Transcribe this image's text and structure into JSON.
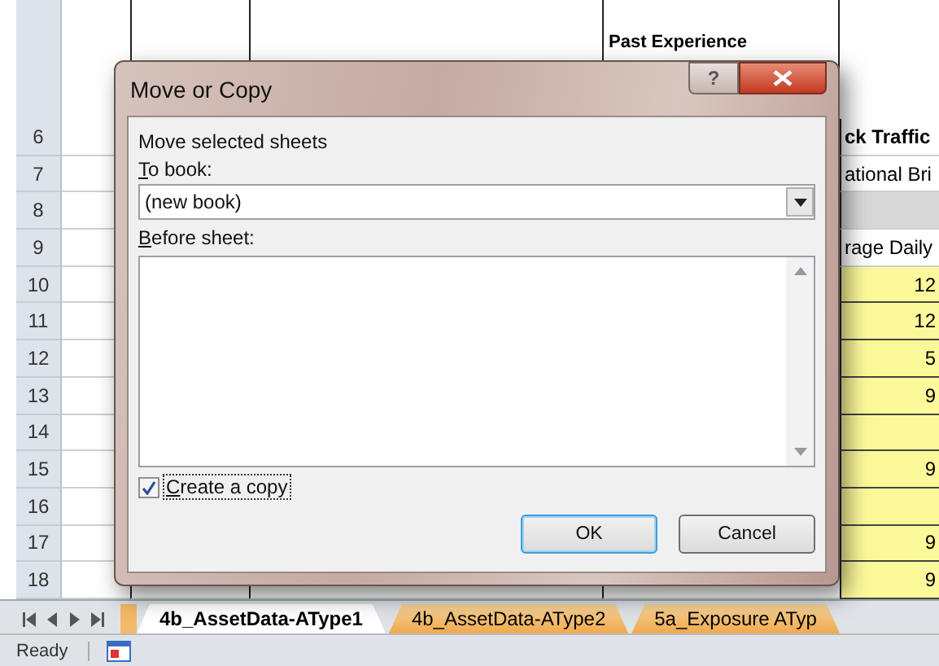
{
  "sheet": {
    "top_header": "Past Experience",
    "rows": [
      {
        "number": "6",
        "cell": "ck Traffic",
        "kind": "header"
      },
      {
        "number": "7",
        "cell": "ational Bri",
        "kind": "label"
      },
      {
        "number": "8",
        "cell": "",
        "kind": "shaded"
      },
      {
        "number": "9",
        "cell": "rage Daily",
        "kind": "label"
      },
      {
        "number": "10",
        "cell": "12",
        "kind": "value"
      },
      {
        "number": "11",
        "cell": "12",
        "kind": "value"
      },
      {
        "number": "12",
        "cell": "5",
        "kind": "value"
      },
      {
        "number": "13",
        "cell": "9",
        "kind": "value"
      },
      {
        "number": "14",
        "cell": "",
        "kind": "value"
      },
      {
        "number": "15",
        "cell": "9",
        "kind": "value"
      },
      {
        "number": "16",
        "cell": "",
        "kind": "value"
      },
      {
        "number": "17",
        "cell": "9",
        "kind": "value"
      },
      {
        "number": "18",
        "cell": "9",
        "kind": "value"
      }
    ]
  },
  "dialog": {
    "title": "Move or Copy",
    "help": "?",
    "section_label": "Move selected sheets",
    "to_book_label": "To book:",
    "to_book_value": "(new book)",
    "before_sheet_label": "Before sheet:",
    "create_copy": {
      "label": "Create a copy",
      "checked": true
    },
    "buttons": [
      {
        "label": "OK",
        "default": true
      },
      {
        "label": "Cancel",
        "default": false
      }
    ]
  },
  "sheet_tabs": [
    {
      "label": "4b_AssetData-AType1",
      "selected": true
    },
    {
      "label": "4b_AssetData-AType2",
      "selected": false
    },
    {
      "label": "5a_Exposure ATyp",
      "selected": false
    }
  ],
  "status_bar": {
    "text": "Ready"
  }
}
